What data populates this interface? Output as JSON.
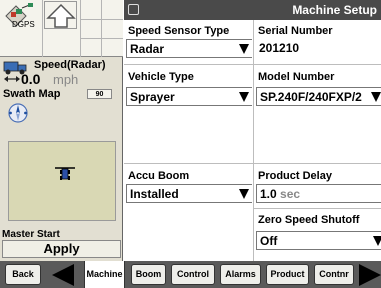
{
  "left": {
    "dgps_label": "DGPS",
    "speed": {
      "title": "Speed(Radar)",
      "value": "0.0",
      "unit": "mph"
    },
    "swath": {
      "title": "Swath Map",
      "badge": "90"
    },
    "master": {
      "label": "Master Start",
      "button": "Apply"
    }
  },
  "header": {
    "title": "Machine Setup"
  },
  "fields": {
    "speed_sensor_type": {
      "label": "Speed Sensor Type",
      "value": "Radar"
    },
    "serial_number": {
      "label": "Serial Number",
      "value": "201210"
    },
    "vehicle_type": {
      "label": "Vehicle Type",
      "value": "Sprayer"
    },
    "model_number": {
      "label": "Model Number",
      "value": "SP.240F/240FXP/2"
    },
    "accu_boom": {
      "label": "Accu Boom",
      "value": "Installed"
    },
    "product_delay": {
      "label": "Product Delay",
      "value": "1.0",
      "unit": "sec"
    },
    "zero_speed_shutoff": {
      "label": "Zero Speed Shutoff",
      "value": "Off"
    }
  },
  "nav": {
    "back": "Back",
    "machine": "Machine",
    "tabs": [
      "Boom",
      "Control",
      "Alarms",
      "Product",
      "Contnr"
    ]
  },
  "colors": {
    "title_bar": "#4a4a4a",
    "panel_bg": "#e2dfd2",
    "map_bg": "#d9d8b4",
    "nav_bg": "#5a5a5a"
  },
  "icons": [
    "dgps-icon",
    "up-arrow-icon",
    "speed-radar-icon",
    "compass-icon",
    "sprayer-icon",
    "back-arrow-icon",
    "forward-arrow-icon",
    "dropdown-arrow-icon"
  ]
}
